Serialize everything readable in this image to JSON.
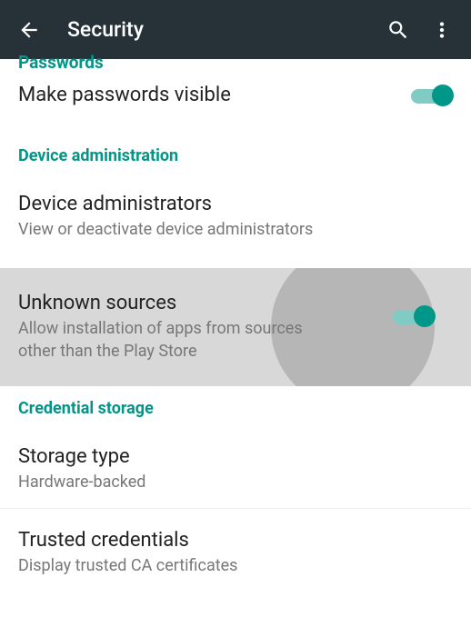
{
  "colors": {
    "accent": "#009688",
    "accent_light": "#80cbc4",
    "appbar": "#263238"
  },
  "appbar": {
    "title": "Security",
    "back_icon": "arrow-back",
    "search_icon": "search",
    "overflow_icon": "more-vert"
  },
  "sections": {
    "passwords": {
      "header": "Passwords",
      "make_visible": {
        "title": "Make passwords visible",
        "toggle_on": true
      }
    },
    "device_admin": {
      "header": "Device administration",
      "device_admins": {
        "title": "Device administrators",
        "subtitle": "View or deactivate device administrators"
      },
      "unknown_sources": {
        "title": "Unknown sources",
        "subtitle": "Allow installation of apps from sources other than the Play Store",
        "toggle_on": true,
        "pressed": true
      }
    },
    "credential_storage": {
      "header": "Credential storage",
      "storage_type": {
        "title": "Storage type",
        "subtitle": "Hardware-backed"
      },
      "trusted_credentials": {
        "title": "Trusted credentials",
        "subtitle": "Display trusted CA certificates"
      }
    }
  }
}
